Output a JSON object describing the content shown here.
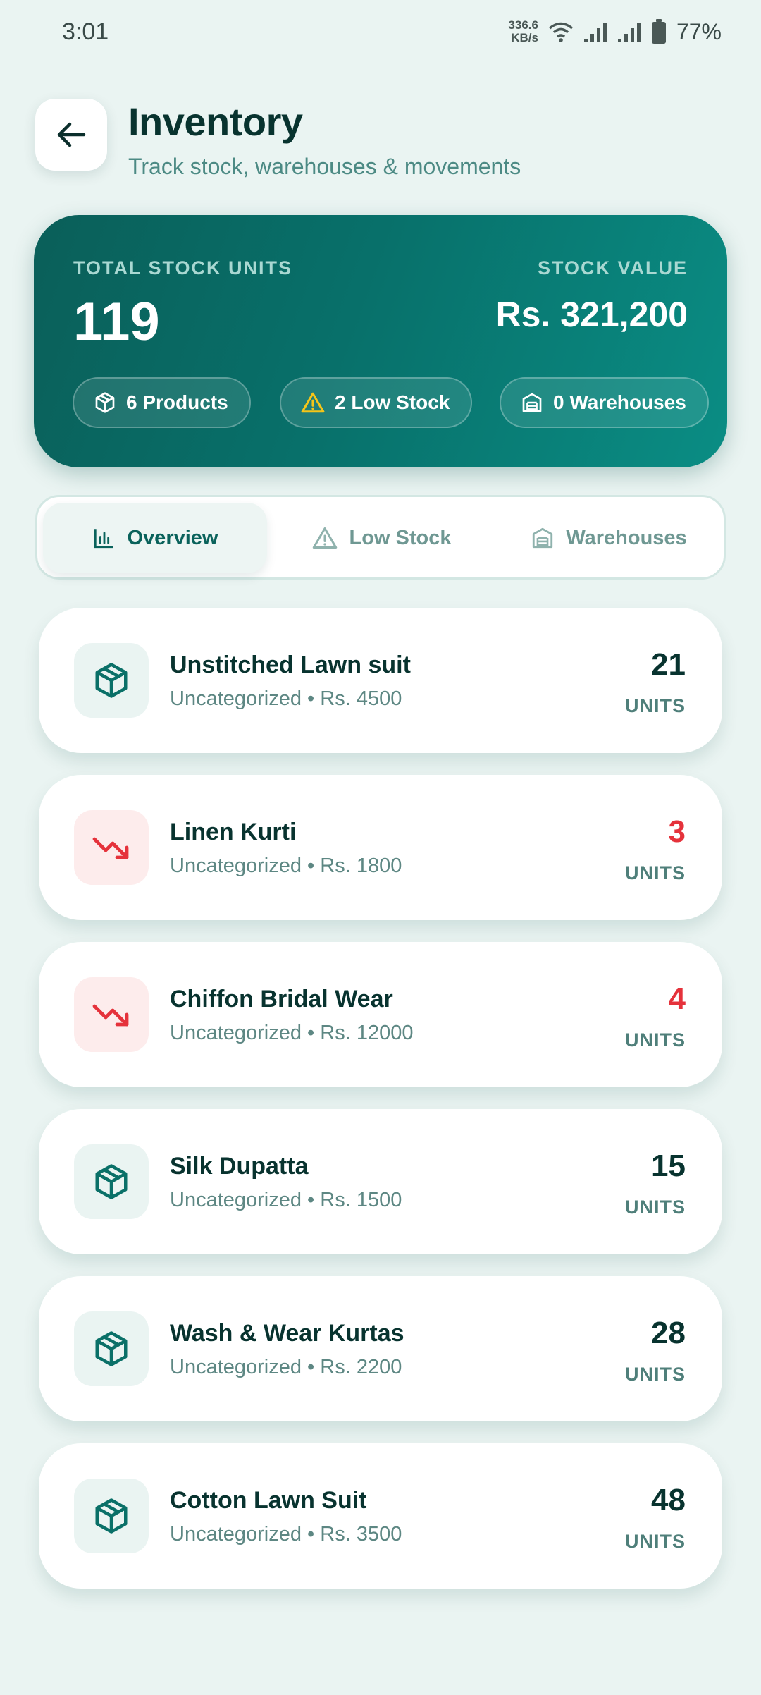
{
  "status_bar": {
    "time": "3:01",
    "net_speed_value": "336.6",
    "net_speed_unit": "KB/s",
    "battery": "77%"
  },
  "header": {
    "title": "Inventory",
    "subtitle": "Track stock, warehouses & movements"
  },
  "summary": {
    "total_units_label": "TOTAL STOCK UNITS",
    "total_units": "119",
    "stock_value_label": "STOCK VALUE",
    "stock_value": "Rs. 321,200",
    "chips": {
      "products": "6 Products",
      "low_stock": "2 Low Stock",
      "warehouses": "0 Warehouses"
    }
  },
  "tabs": {
    "overview": "Overview",
    "low_stock": "Low Stock",
    "warehouses": "Warehouses"
  },
  "products": [
    {
      "name": "Unstitched Lawn suit",
      "meta": "Uncategorized • Rs. 4500",
      "qty": "21",
      "unit": "UNITS",
      "status": "normal"
    },
    {
      "name": "Linen Kurti",
      "meta": "Uncategorized • Rs. 1800",
      "qty": "3",
      "unit": "UNITS",
      "status": "low"
    },
    {
      "name": "Chiffon Bridal Wear",
      "meta": "Uncategorized • Rs. 12000",
      "qty": "4",
      "unit": "UNITS",
      "status": "low"
    },
    {
      "name": "Silk Dupatta",
      "meta": "Uncategorized • Rs. 1500",
      "qty": "15",
      "unit": "UNITS",
      "status": "normal"
    },
    {
      "name": "Wash & Wear Kurtas",
      "meta": "Uncategorized • Rs. 2200",
      "qty": "28",
      "unit": "UNITS",
      "status": "normal"
    },
    {
      "name": "Cotton Lawn Suit",
      "meta": "Uncategorized • Rs. 3500",
      "qty": "48",
      "unit": "UNITS",
      "status": "normal"
    }
  ],
  "colors": {
    "accent": "#0a625b",
    "low_stock": "#e5323b",
    "background": "#eaf4f2"
  }
}
